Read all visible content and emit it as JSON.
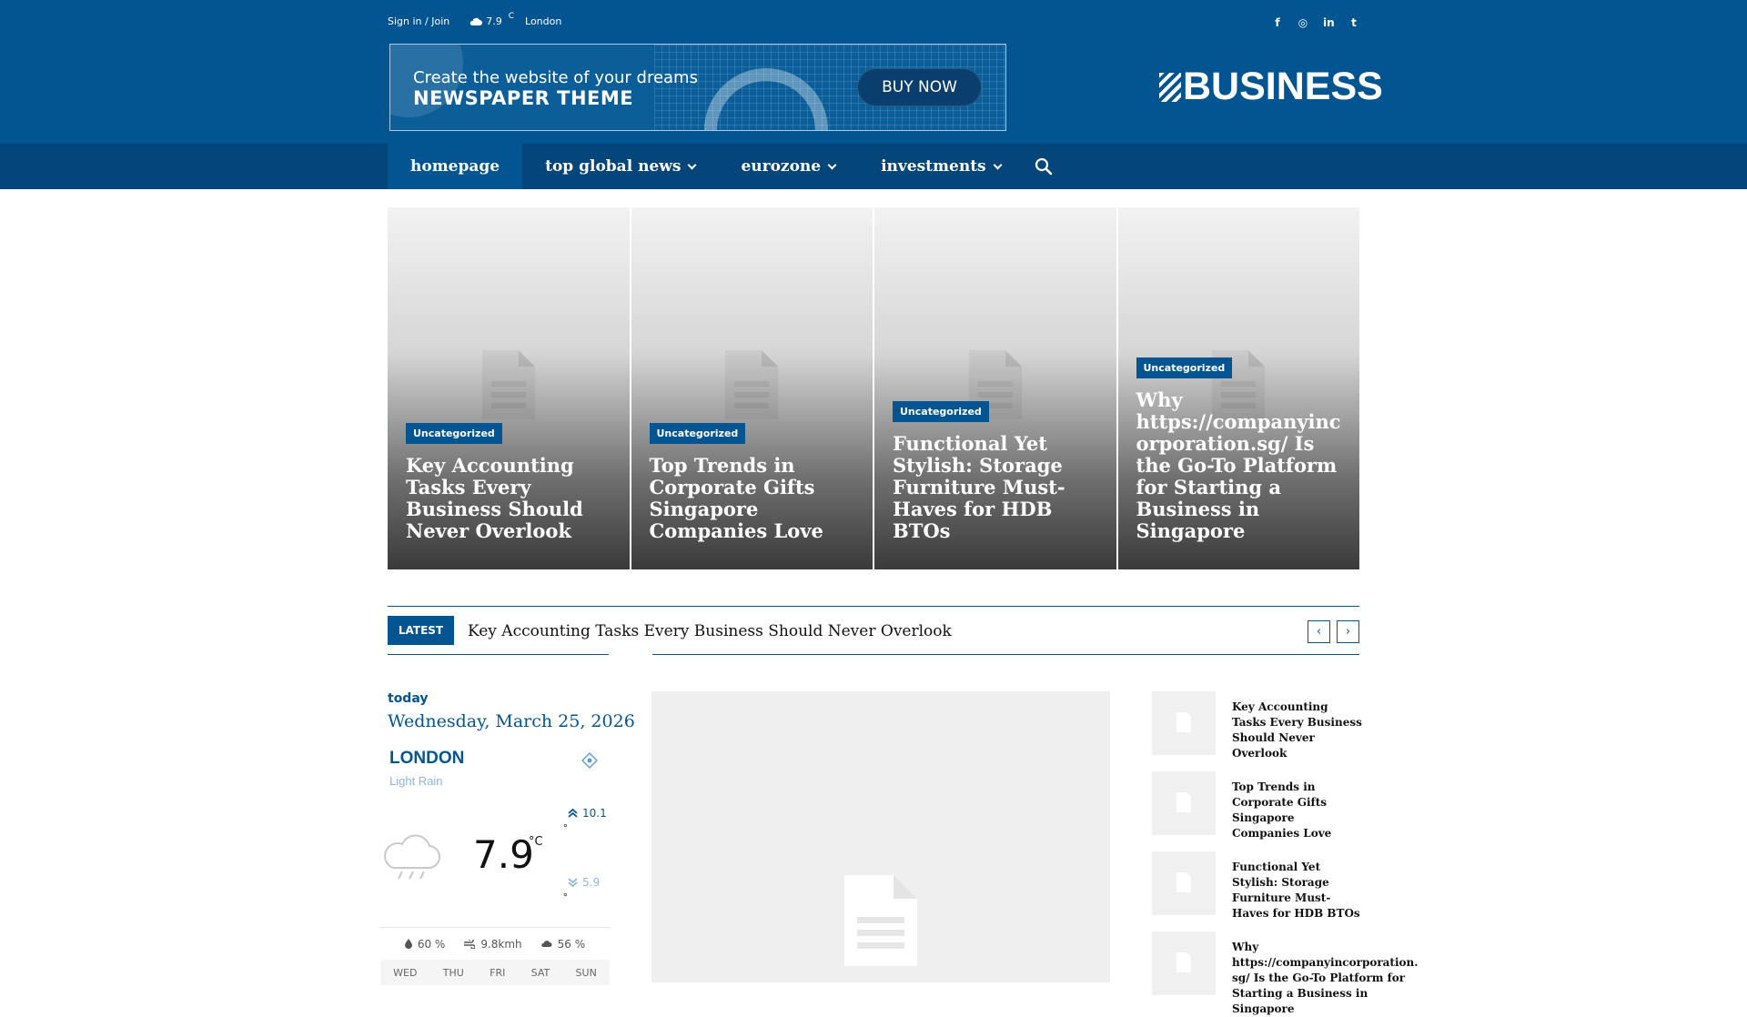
{
  "topbar": {
    "signin": "Sign in / Join",
    "temp": "7.9",
    "unit": "C",
    "city": "London"
  },
  "social": [
    "f",
    "◎",
    "in",
    "t"
  ],
  "banner": {
    "line1": "Create the website of your dreams",
    "line2": "NEWSPAPER THEME",
    "button": "BUY NOW"
  },
  "logo": {
    "text": "BUSINESS"
  },
  "nav": {
    "items": [
      {
        "label": "homepage"
      },
      {
        "label": "top global news"
      },
      {
        "label": "eurozone"
      },
      {
        "label": "investments"
      }
    ]
  },
  "grid": [
    {
      "badge": "Uncategorized",
      "title": "Key Accounting Tasks Every Business Should Never Overlook"
    },
    {
      "badge": "Uncategorized",
      "title": "Top Trends in Corporate Gifts Singapore Companies Love"
    },
    {
      "badge": "Uncategorized",
      "title": "Functional Yet Stylish: Storage Furniture Must-Haves for HDB BTOs"
    },
    {
      "badge": "Uncategorized",
      "title": "Why https://companyincorporation.sg/ Is the Go-To Platform for Starting a Business in Singapore"
    }
  ],
  "ticker": {
    "label": "LATEST",
    "text": "Key Accounting Tasks Every Business Should Never Overlook",
    "prev": "‹",
    "next": "›"
  },
  "today": {
    "label": "today",
    "date": "Wednesday, March 25, 2026"
  },
  "weather": {
    "city": "LONDON",
    "desc": "Light Rain",
    "temp": "7.9",
    "unit": "°C",
    "high": "10.1",
    "low": "5.9",
    "deg": "°",
    "humidity": "60 %",
    "wind": "9.8kmh",
    "clouds": "56 %",
    "days": [
      "WED",
      "THU",
      "FRI",
      "SAT",
      "SUN"
    ]
  },
  "side": [
    {
      "title": "Key Accounting Tasks Every Business Should Never Overlook"
    },
    {
      "title": "Top Trends in Corporate Gifts Singapore Companies Love"
    },
    {
      "title": "Functional Yet Stylish: Storage Furniture Must-Haves for HDB BTOs"
    },
    {
      "title": "Why https://companyincorporation.sg/ Is the Go-To Platform for Starting a Business in Singapore"
    }
  ]
}
